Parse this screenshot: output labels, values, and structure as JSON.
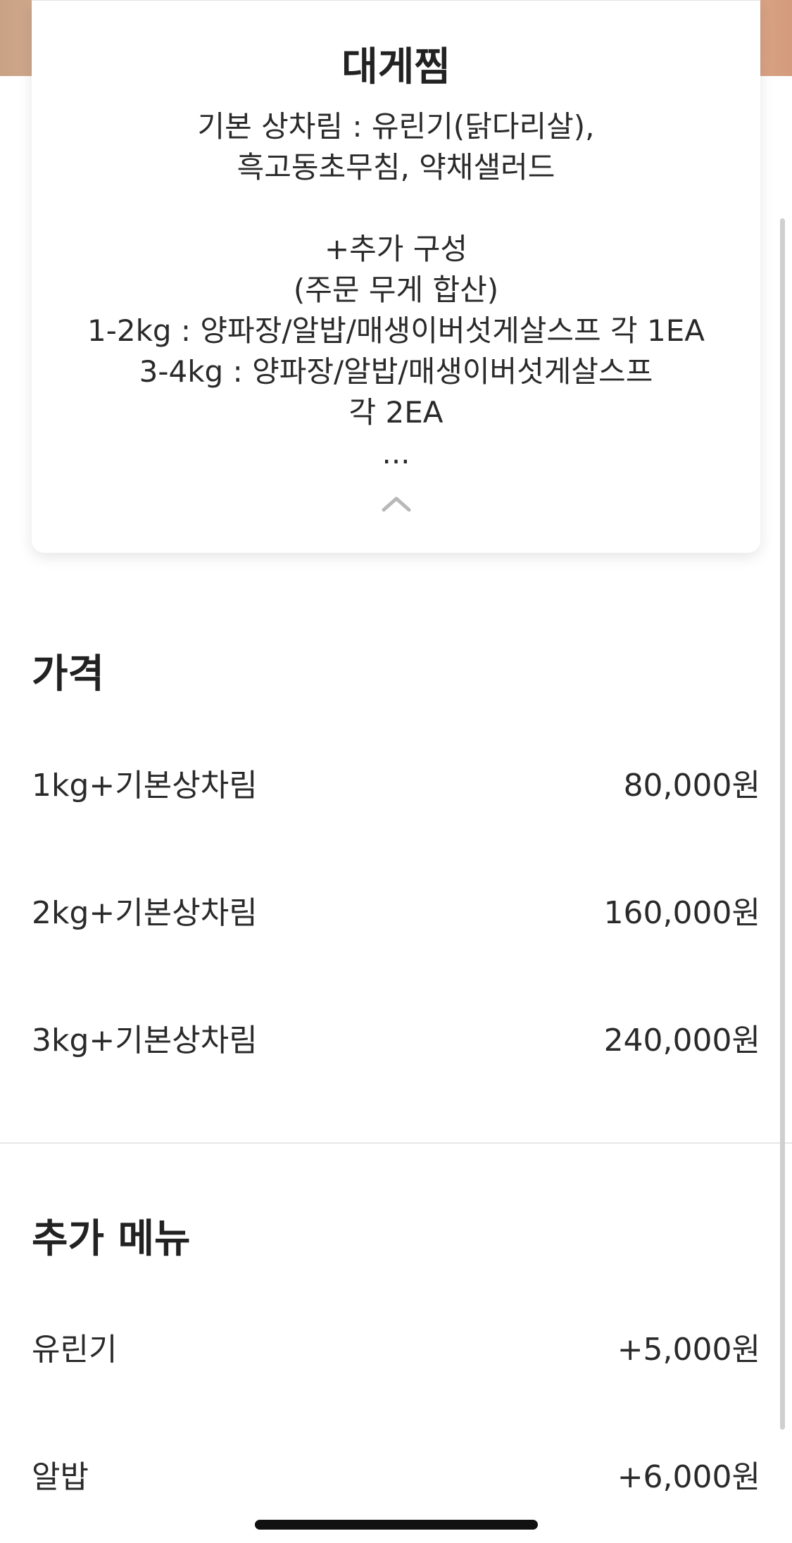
{
  "card": {
    "title": "대게찜",
    "description_lines": [
      "기본 상차림 : 유린기(닭다리살),",
      "흑고동초무침, 약채샐러드",
      "",
      "+추가 구성",
      "(주문 무게 합산)",
      "1-2kg : 양파장/알밥/매생이버섯게살스프 각 1EA",
      "3-4kg : 양파장/알밥/매생이버섯게살스프",
      "각 2EA",
      "..."
    ],
    "collapse_icon": "chevron-up-icon"
  },
  "price_section": {
    "title": "가격",
    "items": [
      {
        "name": "1kg+기본상차림",
        "price": "80,000원"
      },
      {
        "name": "2kg+기본상차림",
        "price": "160,000원"
      },
      {
        "name": "3kg+기본상차림",
        "price": "240,000원"
      }
    ]
  },
  "extra_section": {
    "title": "추가 메뉴",
    "items": [
      {
        "name": "유린기",
        "price": "+5,000원"
      },
      {
        "name": "알밥",
        "price": "+6,000원"
      }
    ]
  }
}
